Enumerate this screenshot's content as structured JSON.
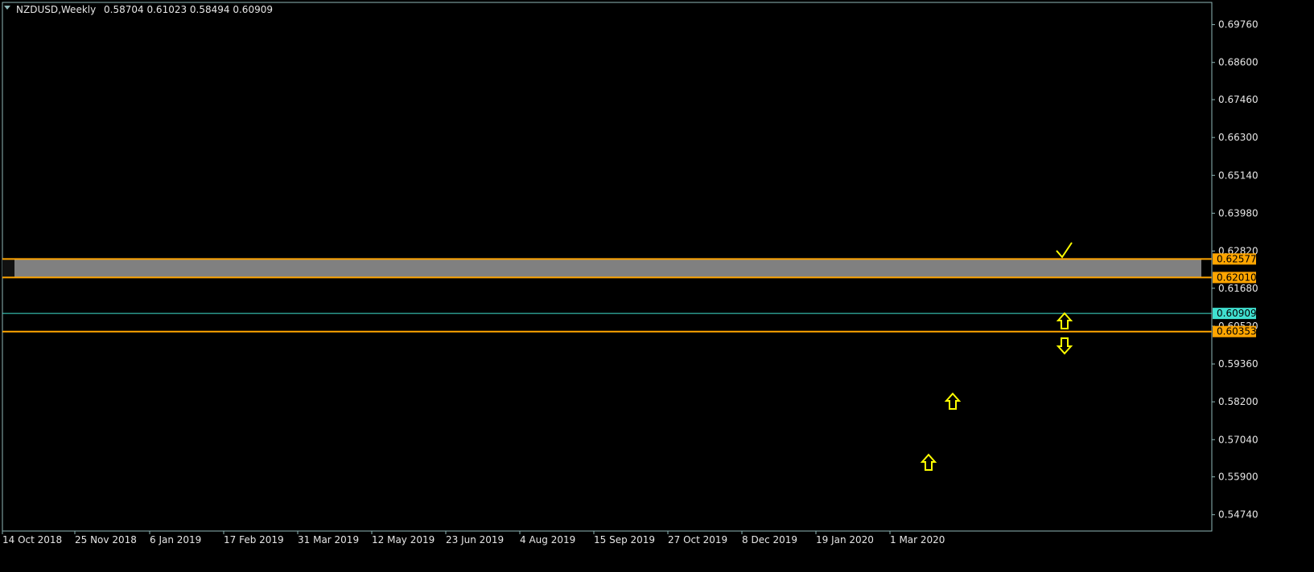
{
  "header": {
    "symbol_timeframe": "NZDUSD,Weekly",
    "ohlc": "0.58704 0.61023 0.58494 0.60909"
  },
  "chart_data": {
    "type": "candlestick",
    "y_range": [
      0.5424,
      0.7044
    ],
    "price_ticks": [
      "0.69760",
      "0.68600",
      "0.67460",
      "0.66300",
      "0.65140",
      "0.63980",
      "0.62820",
      "0.61680",
      "0.60520",
      "0.59360",
      "0.58200",
      "0.57040",
      "0.55900",
      "0.54740"
    ],
    "date_ticks": [
      "14 Oct 2018",
      "25 Nov 2018",
      "6 Jan 2019",
      "17 Feb 2019",
      "31 Mar 2019",
      "12 May 2019",
      "23 Jun 2019",
      "4 Aug 2019",
      "15 Sep 2019",
      "27 Oct 2019",
      "8 Dec 2019",
      "19 Jan 2020",
      "1 Mar 2020"
    ],
    "level_tags": [
      {
        "label": "0.62577",
        "price": 0.62577,
        "color": "#ffa500"
      },
      {
        "label": "0.62010",
        "price": 0.6201,
        "color": "#ffa500"
      },
      {
        "label": "0.60909",
        "price": 0.60909,
        "color": "#40e0d0"
      },
      {
        "label": "0.60353",
        "price": 0.60353,
        "color": "#ffa500"
      }
    ],
    "zone": {
      "top": 0.62577,
      "bottom": 0.6201,
      "color": "#808080"
    },
    "colors": {
      "bull": "#1f1fff",
      "bear": "#e0203c",
      "grid": "#1e5a5a",
      "axis": "#8fb8b8",
      "annot": "#ffff00"
    },
    "annotations": [
      {
        "type": "check",
        "icon": "check-icon",
        "near": "0.62577"
      },
      {
        "type": "arrow-up",
        "icon": "arrow-up-icon",
        "near": "0.60909"
      },
      {
        "type": "arrow-down",
        "icon": "arrow-down-icon",
        "near": "0.60353"
      },
      {
        "type": "arrow-up",
        "icon": "arrow-up-icon",
        "near": "candle-79"
      },
      {
        "type": "arrow-up",
        "icon": "arrow-up-icon",
        "near": "candle-81"
      }
    ]
  }
}
